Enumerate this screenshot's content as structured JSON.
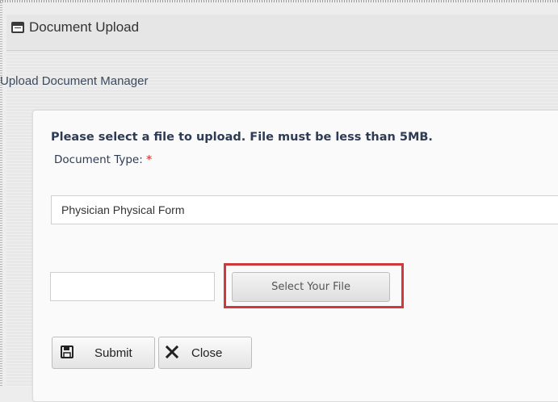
{
  "window": {
    "title": "Document Upload",
    "icon": "document-window-icon"
  },
  "manager": {
    "title": "Upload Document Manager"
  },
  "form": {
    "instruction": "Please select a file to upload. File must be less than 5MB.",
    "document_type_label": "Document Type:",
    "required_marker": "*",
    "document_type_value": "Physician Physical Form",
    "file_path_value": "",
    "select_file_label": "Select Your File"
  },
  "actions": {
    "submit_label": "Submit",
    "submit_icon": "save-icon",
    "close_label": "Close",
    "close_icon": "close-icon"
  },
  "colors": {
    "highlight": "#d0393b",
    "required": "#d9534f",
    "heading_text": "#2d3b55"
  }
}
